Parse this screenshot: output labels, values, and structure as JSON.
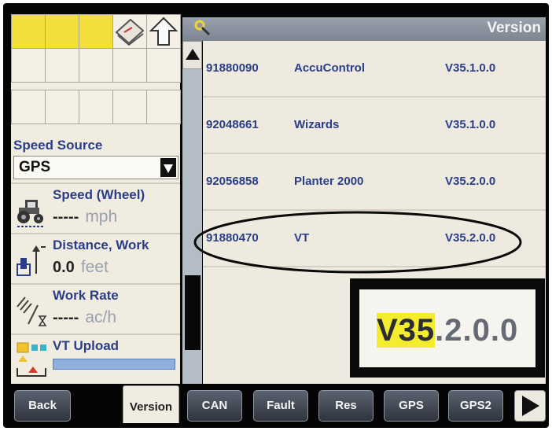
{
  "header": {
    "title": "Version"
  },
  "left_panel": {
    "speed_source": {
      "label": "Speed Source",
      "value": "GPS"
    },
    "widgets": [
      {
        "title": "Speed (Wheel)",
        "value": "-----",
        "unit": "mph",
        "icon": "tractor-icon"
      },
      {
        "title": "Distance, Work",
        "value": "0.0",
        "unit": "feet",
        "icon": "distance-icon"
      },
      {
        "title": "Work Rate",
        "value": "-----",
        "unit": "ac/h",
        "icon": "work-rate-icon"
      },
      {
        "title": "VT Upload",
        "icon": "vt-upload-icon"
      }
    ]
  },
  "versions": [
    {
      "part": "91880090",
      "name": "AccuControl",
      "version": "V35.1.0.0"
    },
    {
      "part": "92048661",
      "name": "Wizards",
      "version": "V35.1.0.0"
    },
    {
      "part": "92056858",
      "name": "Planter 2000",
      "version": "V35.2.0.0"
    },
    {
      "part": "91880470",
      "name": "VT",
      "version": "V35.2.0.0"
    }
  ],
  "zoom_callout": {
    "highlighted": "V35",
    "rest": ".2.0.0"
  },
  "tabs": [
    {
      "label": "Back"
    },
    {
      "label": "Version"
    },
    {
      "label": "CAN"
    },
    {
      "label": "Fault"
    },
    {
      "label": "Res"
    },
    {
      "label": "GPS"
    },
    {
      "label": "GPS2"
    }
  ],
  "colors": {
    "accent_text": "#2a3e88",
    "highlight": "#f4ec2e",
    "grid_yellow": "#f2df3a"
  }
}
